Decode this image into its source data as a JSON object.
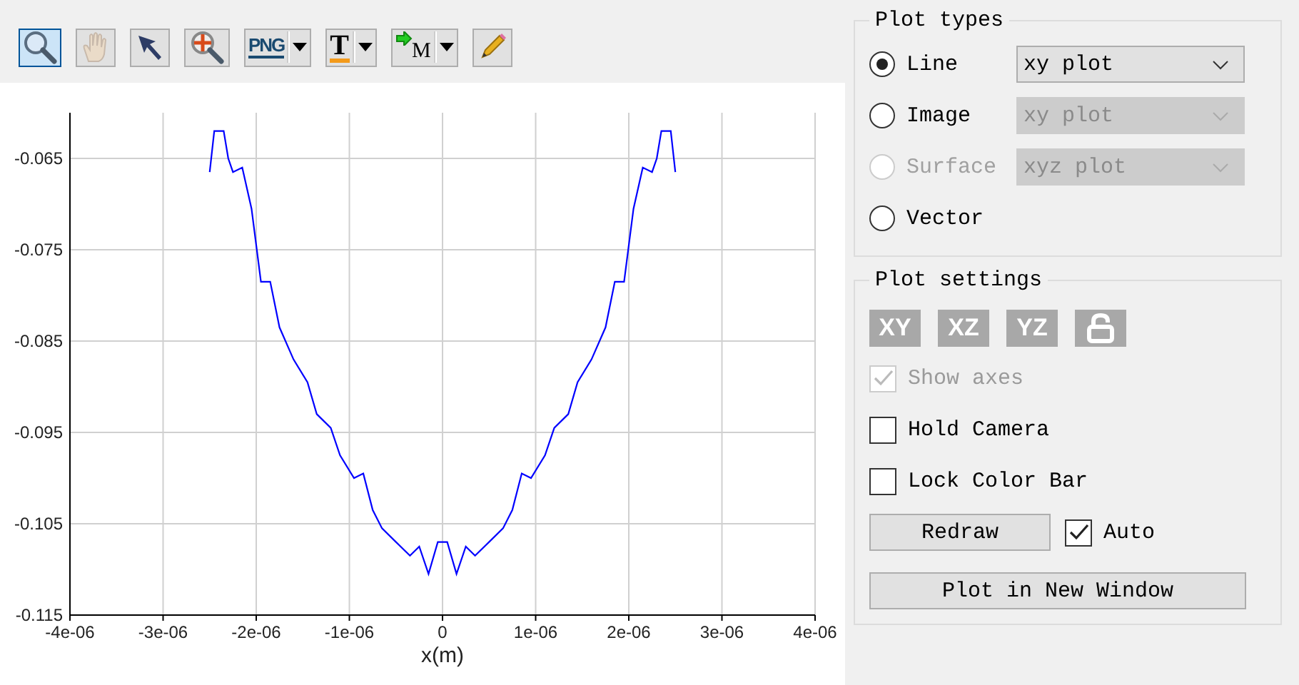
{
  "toolbar": [
    {
      "kind": "zoom",
      "selected": true,
      "disabled": false
    },
    {
      "kind": "pan",
      "selected": false,
      "disabled": true
    },
    {
      "kind": "pointer",
      "selected": false,
      "disabled": false
    },
    {
      "kind": "zoom-target",
      "selected": false,
      "disabled": false
    },
    {
      "kind": "export",
      "label": "PNG",
      "dropdown": true,
      "selected": false,
      "disabled": false
    },
    {
      "kind": "text",
      "label": "T",
      "dropdown": true,
      "selected": false,
      "disabled": false
    },
    {
      "kind": "marker",
      "label": "M",
      "dropdown": true,
      "selected": false,
      "disabled": false
    },
    {
      "kind": "pencil",
      "selected": false,
      "disabled": false
    }
  ],
  "chart": {
    "chart_data": {
      "type": "line",
      "grid": true,
      "xlabel": "x(m)",
      "xlim": [
        -4e-06,
        4e-06
      ],
      "ylim": [
        -0.115,
        -0.06
      ],
      "xticks": [
        {
          "value": -4e-06,
          "label": "-4e-06"
        },
        {
          "value": -3e-06,
          "label": "-3e-06"
        },
        {
          "value": -2e-06,
          "label": "-2e-06"
        },
        {
          "value": -1e-06,
          "label": "-1e-06"
        },
        {
          "value": 0,
          "label": "0"
        },
        {
          "value": 1e-06,
          "label": "1e-06"
        },
        {
          "value": 2e-06,
          "label": "2e-06"
        },
        {
          "value": 3e-06,
          "label": "3e-06"
        },
        {
          "value": 4e-06,
          "label": "4e-06"
        }
      ],
      "yticks": [
        {
          "value": -0.065,
          "label": "-0.065"
        },
        {
          "value": -0.075,
          "label": "-0.075"
        },
        {
          "value": -0.085,
          "label": "-0.085"
        },
        {
          "value": -0.095,
          "label": "-0.095"
        },
        {
          "value": -0.105,
          "label": "-0.105"
        },
        {
          "value": -0.115,
          "label": "-0.115"
        }
      ],
      "x": [
        -2.5e-06,
        -2.45e-06,
        -2.35e-06,
        -2.3e-06,
        -2.25e-06,
        -2.15e-06,
        -2.05e-06,
        -1.95e-06,
        -1.85e-06,
        -1.75e-06,
        -1.6e-06,
        -1.45e-06,
        -1.35e-06,
        -1.2e-06,
        -1.1e-06,
        -9.5e-07,
        -8.5e-07,
        -7.5e-07,
        -6.5e-07,
        -5e-07,
        -3.5e-07,
        -2.5e-07,
        -1.5e-07,
        -5e-08,
        5e-08,
        1.5e-07,
        2.5e-07,
        3.5e-07,
        5e-07,
        6.5e-07,
        7.5e-07,
        8.5e-07,
        9.5e-07,
        1.1e-06,
        1.2e-06,
        1.35e-06,
        1.45e-06,
        1.6e-06,
        1.75e-06,
        1.85e-06,
        1.95e-06,
        2.05e-06,
        2.15e-06,
        2.25e-06,
        2.3e-06,
        2.35e-06,
        2.45e-06,
        2.5e-06
      ],
      "series": [
        {
          "color": "#0000ff",
          "values": [
            -0.0665,
            -0.062,
            -0.062,
            -0.065,
            -0.0665,
            -0.066,
            -0.0705,
            -0.0785,
            -0.0785,
            -0.0835,
            -0.087,
            -0.0895,
            -0.093,
            -0.0945,
            -0.0975,
            -0.1,
            -0.0995,
            -0.1035,
            -0.1055,
            -0.107,
            -0.1085,
            -0.1075,
            -0.1105,
            -0.107,
            -0.107,
            -0.1105,
            -0.1075,
            -0.1085,
            -0.107,
            -0.1055,
            -0.1035,
            -0.0995,
            -0.1,
            -0.0975,
            -0.0945,
            -0.093,
            -0.0895,
            -0.087,
            -0.0835,
            -0.0785,
            -0.0785,
            -0.0705,
            -0.066,
            -0.0665,
            -0.065,
            -0.062,
            -0.062,
            -0.0665
          ]
        }
      ]
    }
  },
  "plot_types": {
    "title": "Plot types",
    "options": [
      {
        "label": "Line",
        "selected": true,
        "disabled": false,
        "dropdown": {
          "value": "xy plot",
          "disabled": false
        }
      },
      {
        "label": "Image",
        "selected": false,
        "disabled": false,
        "dropdown": {
          "value": "xy plot",
          "disabled": true
        }
      },
      {
        "label": "Surface",
        "selected": false,
        "disabled": true,
        "dropdown": {
          "value": "xyz plot",
          "disabled": true
        }
      },
      {
        "label": "Vector",
        "selected": false,
        "disabled": false
      }
    ]
  },
  "plot_settings": {
    "title": "Plot settings",
    "view_buttons": [
      {
        "kind": "view",
        "label": "XY"
      },
      {
        "kind": "view",
        "label": "XZ"
      },
      {
        "kind": "view",
        "label": "YZ"
      },
      {
        "kind": "lock"
      }
    ],
    "checkboxes": [
      {
        "label": "Show axes",
        "checked": true,
        "disabled": true
      },
      {
        "label": "Hold Camera",
        "checked": false,
        "disabled": false
      },
      {
        "label": "Lock Color Bar",
        "checked": false,
        "disabled": false
      }
    ],
    "redraw_button": "Redraw",
    "auto": {
      "label": "Auto",
      "checked": true,
      "disabled": false
    },
    "new_window_button": "Plot in New Window"
  }
}
